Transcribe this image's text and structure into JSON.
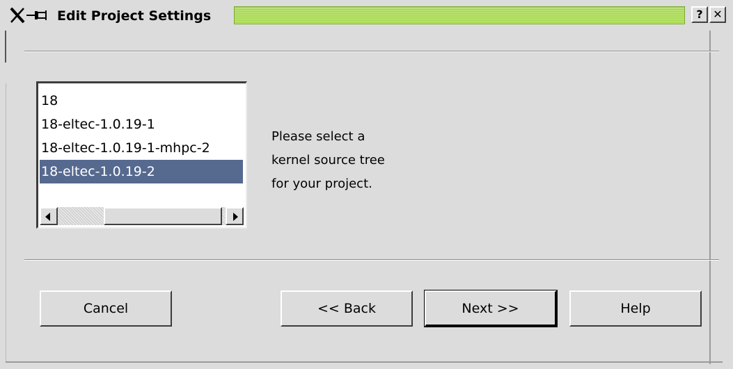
{
  "window": {
    "title": "Edit Project Settings",
    "title_icons": [
      "x-logo-icon",
      "pin-icon"
    ],
    "help_button_label": "?",
    "close_button_label": "✕",
    "titlebar_accent": "#a7d94f"
  },
  "kernel_list": {
    "items": [
      "18",
      "18-eltec-1.0.19-1",
      "18-eltec-1.0.19-1-mhpc-2",
      "18-eltec-1.0.19-2"
    ],
    "selected_index": 3,
    "selected_color": "#56698f"
  },
  "description": {
    "lines": [
      "Please select a",
      "kernel source tree",
      "for your project."
    ]
  },
  "buttons": {
    "cancel": "Cancel",
    "back": "<< Back",
    "next": "Next >>",
    "help": "Help"
  }
}
